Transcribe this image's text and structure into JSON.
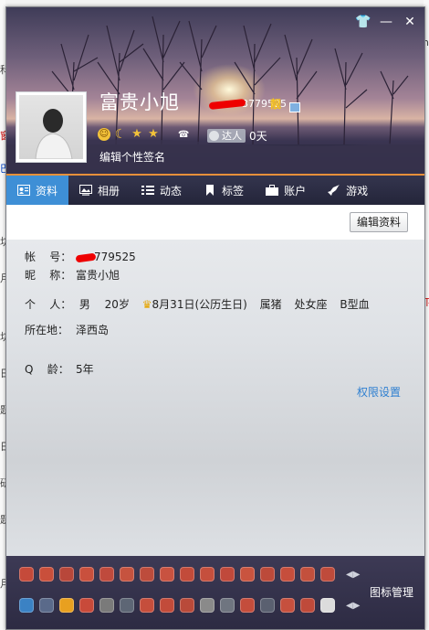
{
  "window": {
    "controls": [
      "shirt-icon",
      "minimize-icon",
      "close-icon"
    ]
  },
  "profile": {
    "nickname": "富贵小旭",
    "qq_visible": "3779525",
    "vip_label": "靓",
    "days": "0天",
    "daren_label": "达人",
    "signature_placeholder": "编辑个性签名"
  },
  "tabs": [
    {
      "label": "资料",
      "icon": "profile-card-icon",
      "active": true
    },
    {
      "label": "相册",
      "icon": "photo-album-icon",
      "active": false
    },
    {
      "label": "动态",
      "icon": "feed-list-icon",
      "active": false
    },
    {
      "label": "标签",
      "icon": "bookmark-icon",
      "active": false
    },
    {
      "label": "账户",
      "icon": "briefcase-icon",
      "active": false
    },
    {
      "label": "游戏",
      "icon": "rocket-icon",
      "active": false
    }
  ],
  "edit_button": "编辑资料",
  "info": {
    "account_label": "帐    号：",
    "account_value": "779525",
    "nickname_label": "昵    称：",
    "nickname_value": "富贵小旭",
    "personal_label": "个    人：",
    "gender": "男",
    "age": "20岁",
    "birthday": "8月31日(公历生日)",
    "zodiac": "属猪",
    "star_sign": "处女座",
    "blood": "B型血",
    "location_label": "所在地：",
    "location_value": "泽西岛",
    "qage_label": "Q    龄：",
    "qage_value": "5年"
  },
  "permission_link": "权限设置",
  "icon_manage": "图标管理",
  "colors": {
    "accent_blue": "#3e8fd6",
    "tab_bar": "#2b2c42",
    "orange_line": "#e7903a",
    "link": "#2e7fd0"
  }
}
